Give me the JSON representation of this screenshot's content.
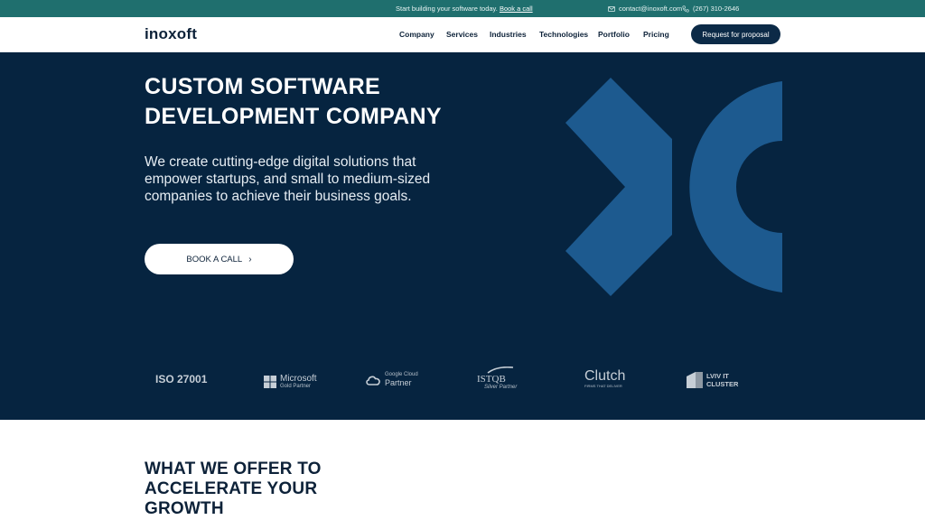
{
  "topbar": {
    "promo_text": "Start building your software today.",
    "promo_link": "Book a call",
    "email": "contact@inoxoft.com",
    "phone": "(267) 310-2646"
  },
  "header": {
    "logo": "inoxoft",
    "nav": [
      "Company",
      "Services",
      "Industries",
      "Technologies",
      "Portfolio",
      "Pricing"
    ],
    "cta": "Request for proposal"
  },
  "hero": {
    "title_lines": [
      "CUSTOM SOFTWARE",
      "DEVELOPMENT COMPANY"
    ],
    "subtitle_lines": [
      "We create cutting-edge digital solutions that",
      "empower startups, and small to medium-sized",
      "companies to achieve their business goals."
    ],
    "button": "BOOK A CALL",
    "graphic_color": "#1d5a8f"
  },
  "partners": [
    {
      "name": "ISO 27001",
      "icon": "iso-badge-icon"
    },
    {
      "name": "Microsoft",
      "caption": "Gold Partner",
      "icon": "microsoft-icon"
    },
    {
      "name": "Google Cloud",
      "caption": "Partner",
      "icon": "google-cloud-icon"
    },
    {
      "name": "ISTQB",
      "caption": "Silver Partner",
      "icon": "istqb-icon"
    },
    {
      "name": "Clutch",
      "caption": "FIRMS THAT DELIVER",
      "icon": "clutch-icon"
    },
    {
      "name": "LVIV IT",
      "caption": "CLUSTER",
      "icon": "lviv-it-cluster-icon"
    }
  ],
  "offer": {
    "title_lines": [
      "WHAT WE OFFER TO",
      "ACCELERATE YOUR",
      "GROWTH"
    ]
  },
  "colors": {
    "topbar": "#1f6f6e",
    "hero_bg": "#062440",
    "cta_bg": "#0c2a47",
    "heading": "#0d2239"
  }
}
